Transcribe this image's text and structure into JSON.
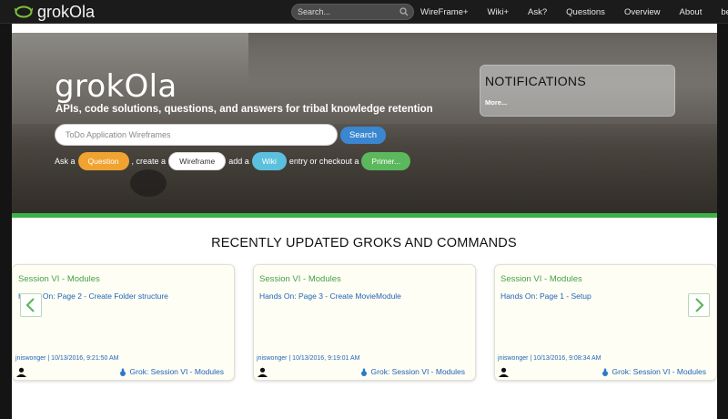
{
  "navbar": {
    "brand": "grokOla",
    "search_placeholder": "Search...",
    "links": [
      "WireFrame+",
      "Wiki+",
      "Ask?",
      "Questions",
      "Overview",
      "About"
    ],
    "user": "beye"
  },
  "hero": {
    "title": "grokOla",
    "subtitle": "APIs, code solutions, questions, and answers for tribal knowledge retention",
    "input_value": "ToDo Application Wireframes",
    "search_button": "Search",
    "cta": {
      "ask": "Ask a",
      "question": "Question",
      "create": ", create a",
      "wireframe": "Wireframe",
      "add": "add a",
      "wiki": "Wiki",
      "entry": "entry or checkout a",
      "primer": "Primer..."
    }
  },
  "notifications": {
    "title": "NOTIFICATIONS",
    "more": "More..."
  },
  "section_title": "RECENTLY UPDATED GROKS AND COMMANDS",
  "cards": [
    {
      "session": "Session VI - Modules",
      "title": "Hands On: Page 2 - Create Folder structure",
      "meta": "jniswonger | 10/13/2016, 9:21:50 AM",
      "grok": "Grok: Session VI - Modules"
    },
    {
      "session": "Session VI - Modules",
      "title": "Hands On: Page 3 - Create MovieModule",
      "meta": "jniswonger | 10/13/2016, 9:19:01 AM",
      "grok": "Grok: Session VI - Modules"
    },
    {
      "session": "Session VI - Modules",
      "title": "Hands On: Page 1 - Setup",
      "meta": "jniswonger | 10/13/2016, 9:08:34 AM",
      "grok": "Grok: Session VI - Modules"
    }
  ],
  "colors": {
    "accent_green": "#3cb14a",
    "search_blue": "#3a87d0",
    "question_orange": "#f0a330",
    "wiki_cyan": "#5bc0de",
    "primer_green": "#5cb85c"
  }
}
